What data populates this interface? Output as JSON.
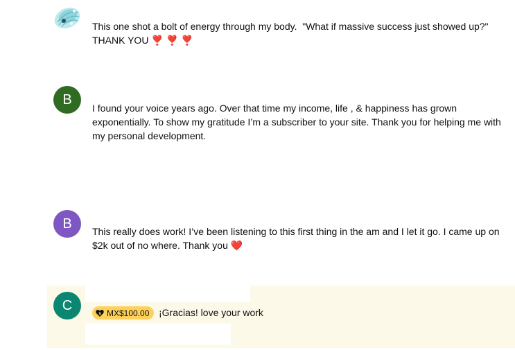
{
  "comments": [
    {
      "avatar_letter": "",
      "avatar_desc": "turquoise-seashell-avatar",
      "text": "This one shot a bolt of energy through my body.  \"What if massive success just showed up?\"\nTHANK YOU",
      "hearts": "❣️ ❣️ ❣️"
    },
    {
      "avatar_letter": "B",
      "avatar_color": "#2f6b22",
      "text": "I found your voice years ago. Over that time my income, life , & happiness has grown exponentially. To show my gratitude I’m a subscriber to your site. Thank you for helping me with my personal development."
    },
    {
      "avatar_letter": "B",
      "avatar_color": "#7e57c2",
      "text": "This really does work! I’ve been listening to this first thing in the am and I let it go. I came up on $2k out of no where. Thank you",
      "hearts": "❤️"
    },
    {
      "avatar_letter": "C",
      "avatar_color": "#0b8670",
      "super_amount": "MX$100.00",
      "text": "¡Gracias! love your work",
      "highlight_color": "#fdf9e9",
      "chip_color": "#fdd15b"
    }
  ]
}
